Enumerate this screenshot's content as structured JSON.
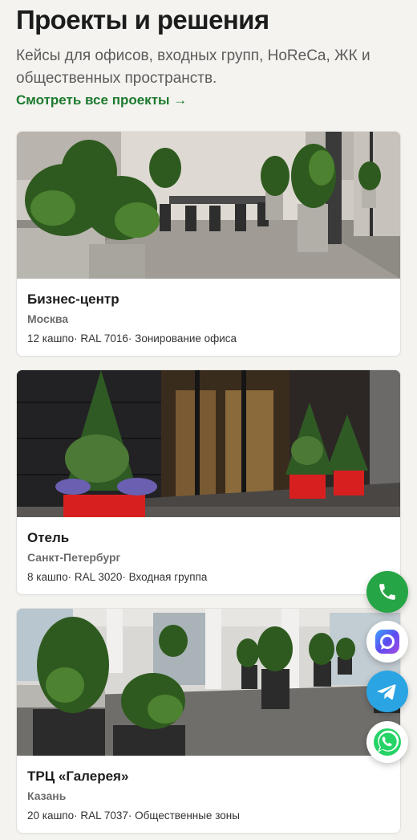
{
  "section": {
    "title": "Проекты и решения",
    "subtitle": "Кейсы для офисов, входных групп, HoReCa, ЖК и общественных пространств.",
    "all_projects_link": "Смотреть все проекты →"
  },
  "projects": [
    {
      "title": "Бизнес-центр",
      "city": "Москва",
      "meta": "12 кашпо· RAL 7016· Зонирование офиса"
    },
    {
      "title": "Отель",
      "city": "Санкт-Петербург",
      "meta": "8 кашпо· RAL 3020· Входная группа"
    },
    {
      "title": "ТРЦ «Галерея»",
      "city": "Казань",
      "meta": "20 кашпо· RAL 7037· Общественные зоны"
    }
  ],
  "contact_buttons": [
    {
      "icon": "phone-icon",
      "color": "#25a545"
    },
    {
      "icon": "max-messenger-icon",
      "color": "#ffffff"
    },
    {
      "icon": "telegram-icon",
      "color": "#2aa4e3"
    },
    {
      "icon": "whatsapp-icon",
      "color": "#ffffff"
    }
  ],
  "colors": {
    "accent": "#1d7a2e",
    "background": "#f4f3ef",
    "text": "#1c1c1c",
    "muted": "#6b6b6b"
  }
}
